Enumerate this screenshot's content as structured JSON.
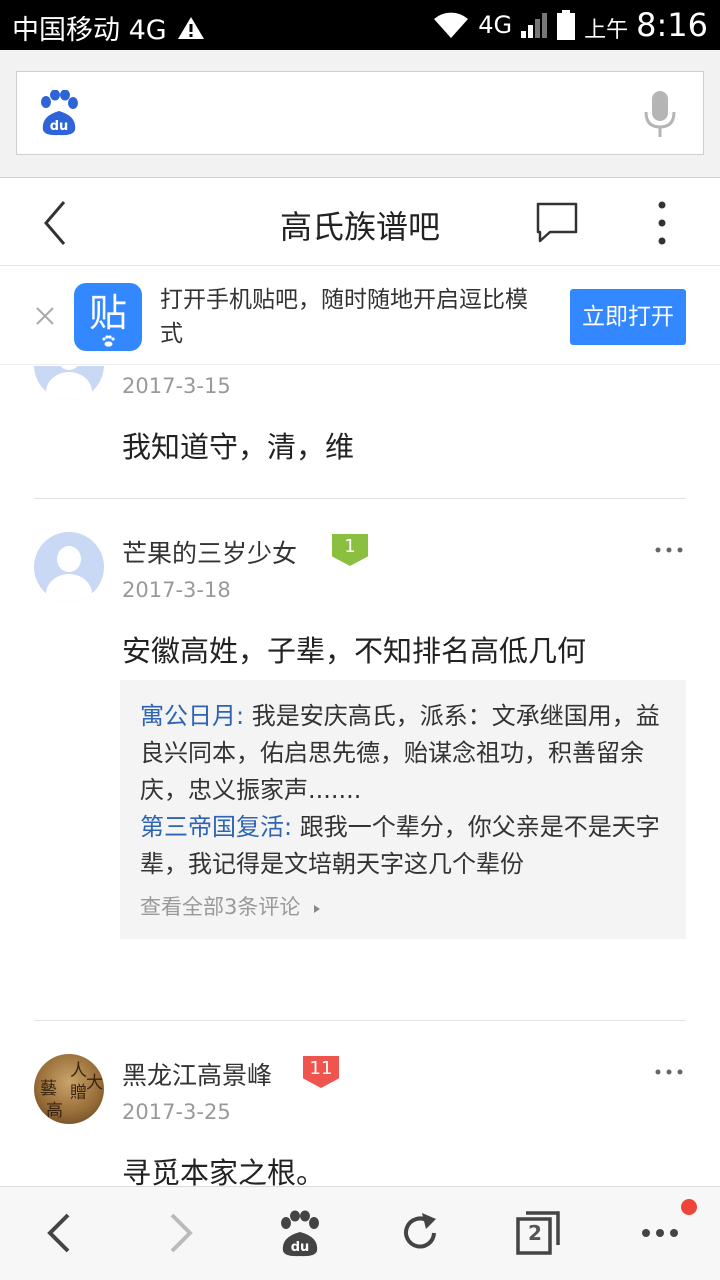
{
  "status_bar": {
    "carrier": "中国移动 4G",
    "network": "4G",
    "ampm": "上午",
    "time": "8:16"
  },
  "browser": {
    "search_placeholder": ""
  },
  "header": {
    "title": "高氏族谱吧"
  },
  "promo": {
    "icon_text": "贴",
    "text": "打开手机贴吧，随时随地开启逗比模式",
    "button_label": "立即打开"
  },
  "posts": [
    {
      "date": "2017-3-15",
      "text": "我知道守，清，维"
    },
    {
      "username": "芒果的三岁少女",
      "level": "1",
      "date": "2017-3-18",
      "text": "安徽高姓，子辈，不知排名高低几何",
      "replies": [
        {
          "author": "寓公日月:",
          "text": " 我是安庆高氏，派系：文承继国用，益良兴同本，佑启思先德，贻谋念祖功，积善留余庆，忠义振家声......."
        },
        {
          "author": "第三帝国复活:",
          "text": " 跟我一个辈分，你父亲是不是天字辈，我记得是文培朝天字这几个辈份"
        }
      ],
      "view_all": "查看全部3条评论"
    },
    {
      "username": "黑龙江高景峰",
      "level": "11",
      "date": "2017-3-25",
      "text": "寻觅本家之根。"
    }
  ],
  "bottom_nav": {
    "tabs_count": "2"
  },
  "colors": {
    "accent": "#3388ff",
    "link": "#2d64b3",
    "badge_green": "#8bbf3f",
    "badge_red": "#f0544f"
  }
}
